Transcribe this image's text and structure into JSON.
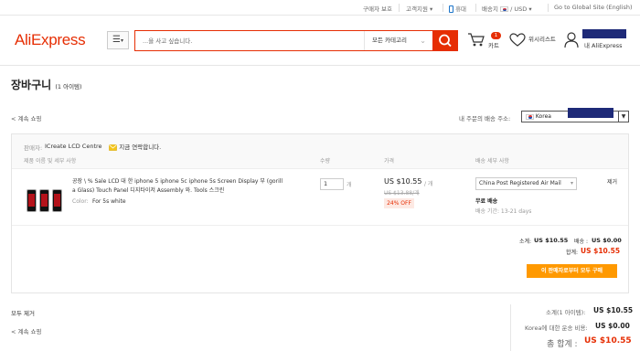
{
  "topbar": {
    "buyer_protection": "구매자 보호",
    "customer_service": "고객지원",
    "mobile": "휴대",
    "ship_to_label": "배송지",
    "currency": "USD",
    "global_site": "Go to Global Site (English)"
  },
  "header": {
    "logo": "AliExpress",
    "search_placeholder": "...을 사고 싶습니다.",
    "all_categories": "모든 카테고리",
    "cart_label": "카트",
    "cart_count": "1",
    "wishlist_label": "위시리스트",
    "my_account_label": "내 AliExpress"
  },
  "page": {
    "title": "장바구니",
    "count": "(1 아이템)",
    "continue_shopping": "< 계속 쇼핑",
    "ship_to_label": "내 주문의 배송 주소:",
    "country": "Korea"
  },
  "store": {
    "seller_label": "판매자:",
    "seller_name": "ICreate LCD Centre",
    "contact": "지금 연락합니다.",
    "col_product": "제품 이름 및 세부 사항",
    "col_qty": "수량",
    "col_price": "가격",
    "col_shipping": "배송 세부 사항"
  },
  "item": {
    "title_line1": "공장 \\ % Sale LCD 대 한 iphone 5 iphone 5c iphone 5s Screen Display 부 (gorill",
    "title_line2": "a Glass) Touch Panel 디지타이저 Assembly 와. Tools 스크린",
    "color_label": "Color:",
    "color_value": "For 5s white",
    "quantity": "1",
    "qty_unit": "개",
    "price": "US $10.55",
    "price_unit": "/ 개",
    "original_price": "US $13.88/개",
    "discount": "24% OFF",
    "shipping_method": "China Post Registered Air Mail",
    "free_shipping": "무료 배송",
    "delivery_time": "배송 기간: 13-21 days",
    "remove": "제거"
  },
  "store_summary": {
    "subtotal_label": "소계:",
    "subtotal": "US $10.55",
    "shipping_label": "배송 :",
    "shipping": "US $0.00",
    "total_label": "합계:",
    "total": "US $10.55",
    "buy_button": "이 판매자로부터 모두 구매"
  },
  "bottom": {
    "remove_all": "모두 제거",
    "continue_shopping": "< 계속 쇼핑",
    "subtotal_label": "소계(1 아이템):",
    "subtotal": "US $10.55",
    "shipping_label": "Korea에 대한 운송 비용:",
    "shipping": "US $0.00",
    "total_label": "총 합계 :",
    "total": "US $10.55"
  },
  "colors": {
    "accent": "#e62e04",
    "buy_button": "#ff9900",
    "redacted_block": "#1e2a78"
  },
  "icons": [
    "phone-icon",
    "korea-flag-icon",
    "menu-icon",
    "search-icon",
    "cart-icon",
    "heart-icon",
    "user-icon",
    "envelope-icon",
    "chevron-down-icon"
  ]
}
